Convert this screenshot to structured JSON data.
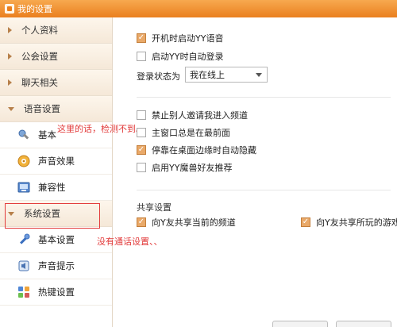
{
  "window": {
    "title": "我的设置"
  },
  "sidebar": {
    "categories": [
      {
        "label": "个人资料"
      },
      {
        "label": "公会设置"
      },
      {
        "label": "聊天相关"
      },
      {
        "label": "语音设置"
      },
      {
        "label": "系统设置"
      }
    ],
    "voice_items": [
      {
        "label": "基本",
        "icon": "wrench-icon"
      },
      {
        "label": "声音效果",
        "icon": "sound-effect-icon"
      },
      {
        "label": "兼容性",
        "icon": "compat-icon"
      }
    ],
    "system_items": [
      {
        "label": "基本设置",
        "icon": "wrench-icon"
      },
      {
        "label": "声音提示",
        "icon": "speaker-icon"
      },
      {
        "label": "热键设置",
        "icon": "hotkey-icon"
      }
    ]
  },
  "annotations": {
    "note1": "这里的话，检测不到。",
    "note2": "没有通话设置、、"
  },
  "main": {
    "startup": [
      {
        "label": "开机时启动YY语音",
        "checked": true
      },
      {
        "label": "启动YY时自动登录",
        "checked": false
      }
    ],
    "login_status": {
      "label": "登录状态为",
      "value": "我在线上"
    },
    "options": [
      {
        "label": "禁止别人邀请我进入频道",
        "checked": false
      },
      {
        "label": "主窗口总是在最前面",
        "checked": false
      },
      {
        "label": "停靠在桌面边缘时自动隐藏",
        "checked": true
      },
      {
        "label": "启用YY魔兽好友推荐",
        "checked": false
      }
    ],
    "share": {
      "title": "共享设置",
      "items": [
        {
          "label": "向Y友共享当前的频道",
          "checked": true
        },
        {
          "label": "向Y友共享所玩的游戏",
          "checked": true
        }
      ]
    }
  },
  "colors": {
    "titlebar": "#ea7f1e",
    "checked": "#e9a969",
    "annotation": "#e23a3a"
  }
}
